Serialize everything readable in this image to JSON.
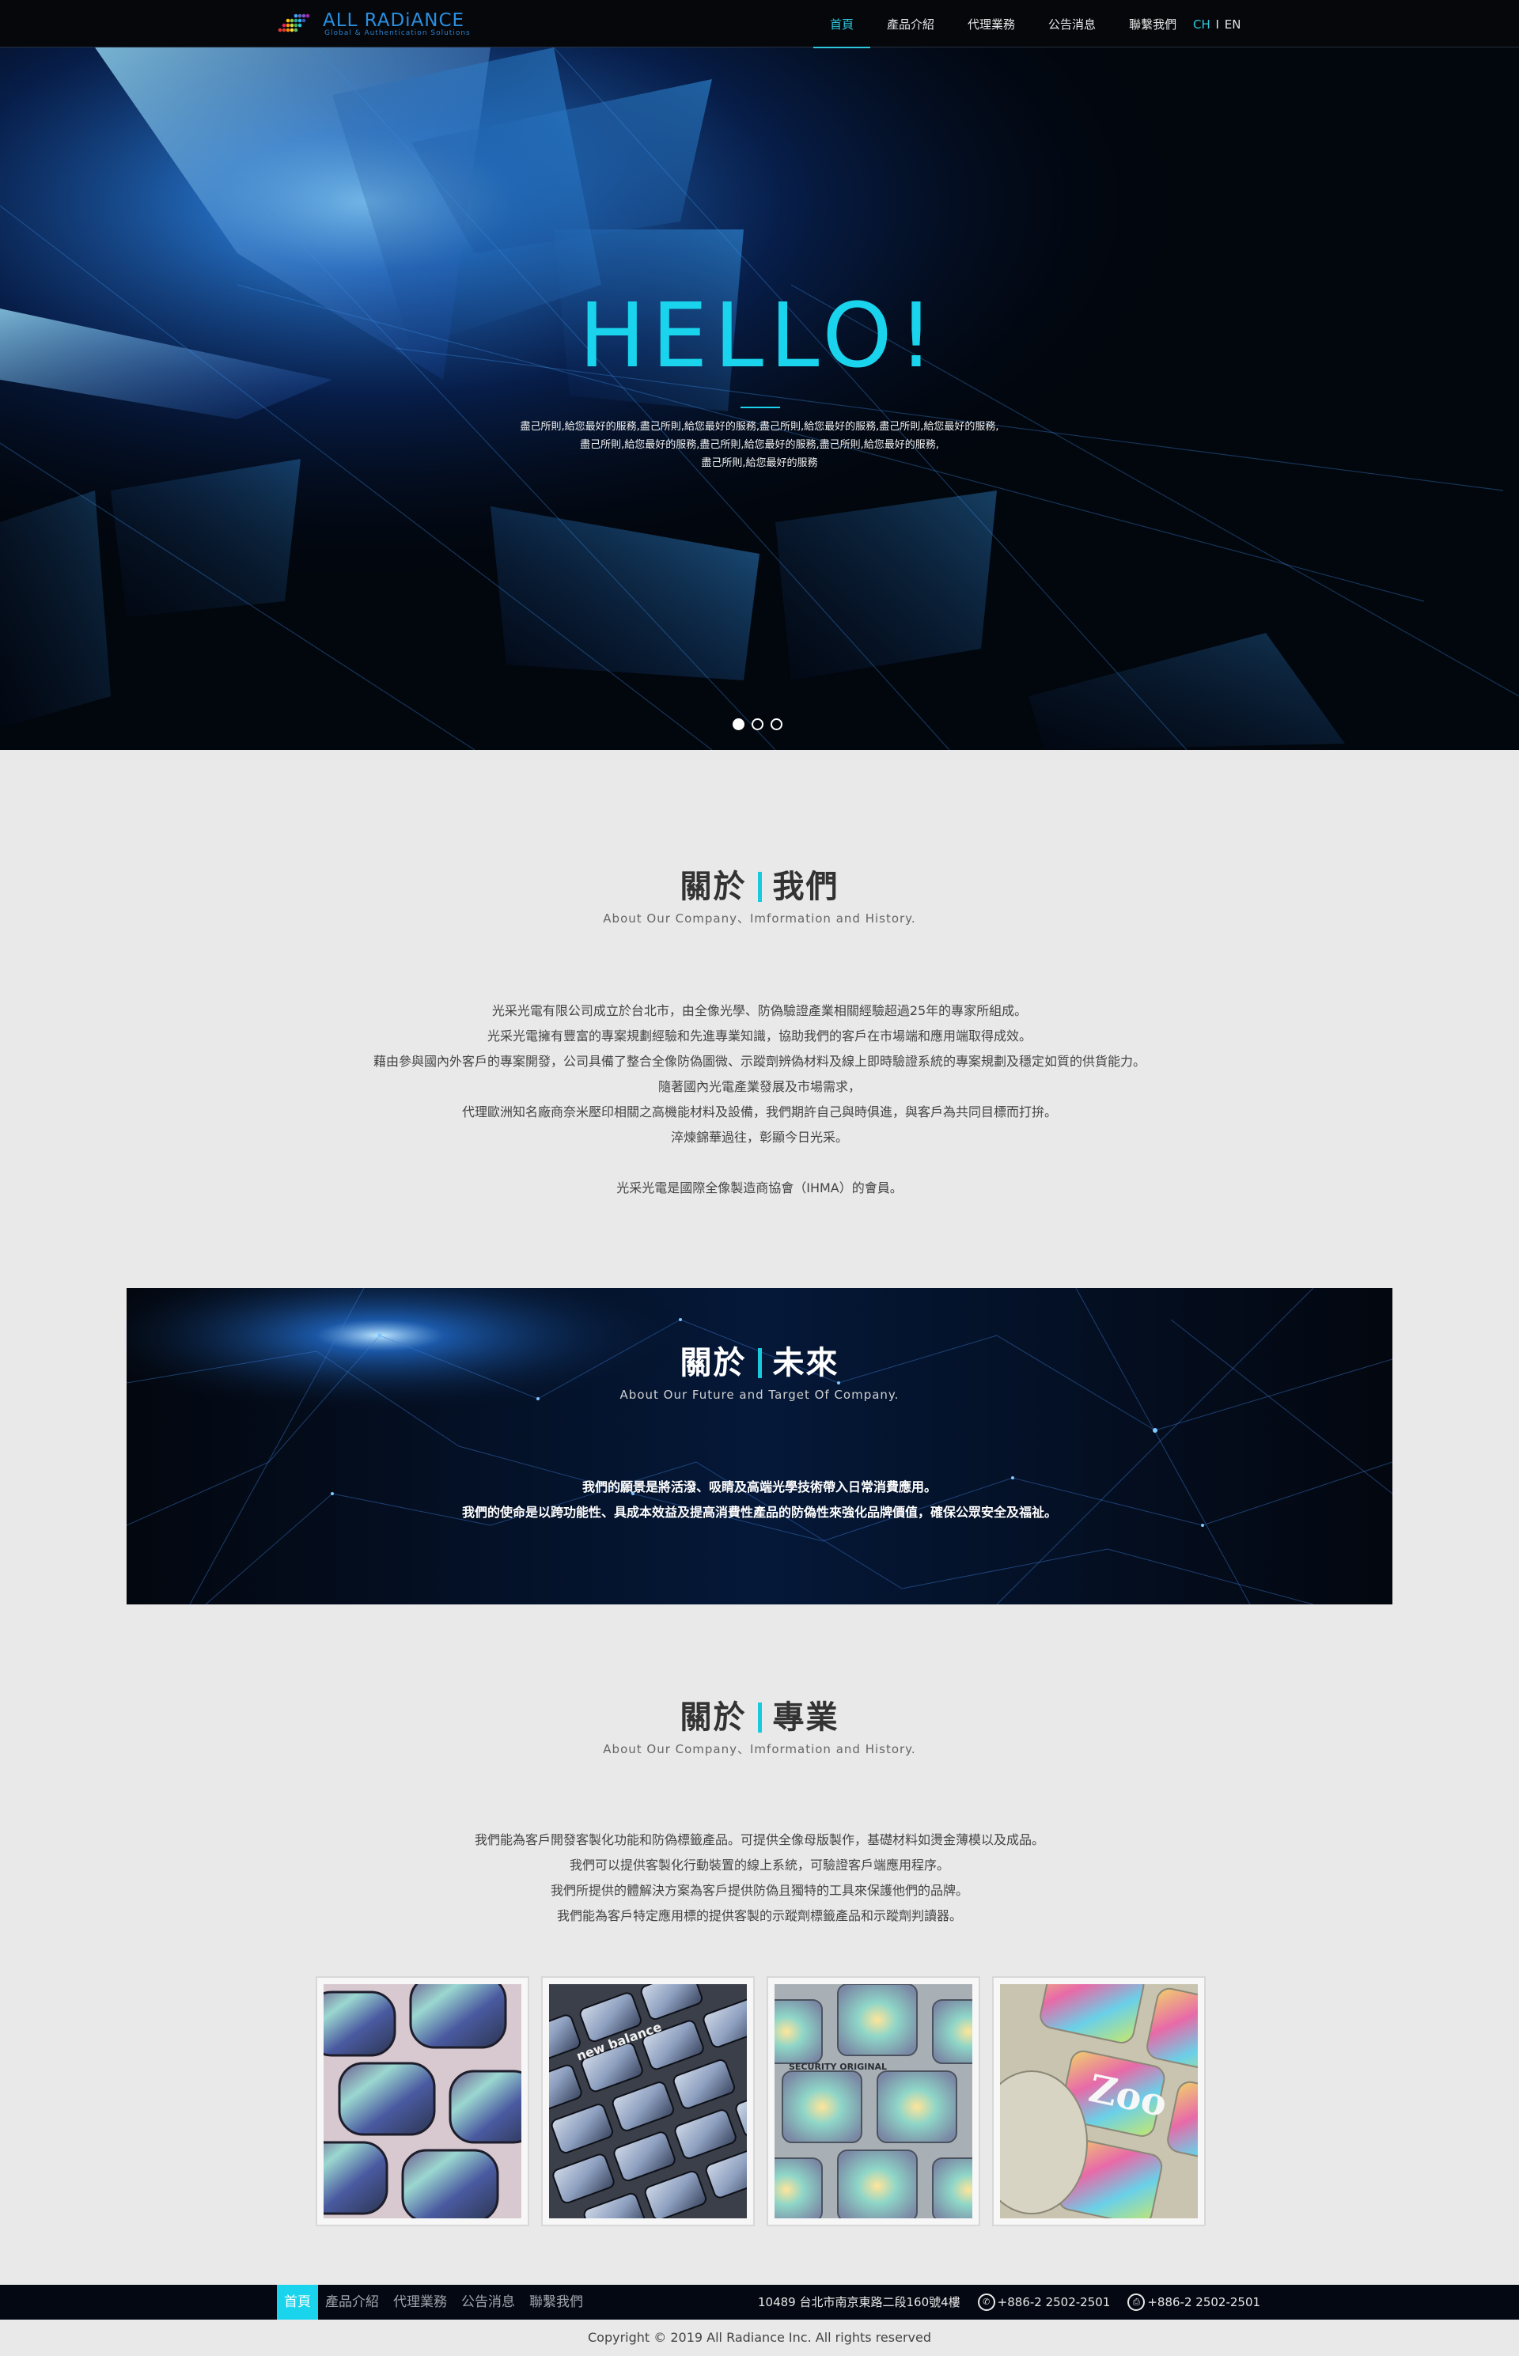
{
  "header": {
    "logo_text": "ALL RADiANCE",
    "logo_sub": "Global & Authentication Solutions",
    "nav": [
      {
        "label": "首頁"
      },
      {
        "label": "產品介紹"
      },
      {
        "label": "代理業務"
      },
      {
        "label": "公告消息"
      },
      {
        "label": "聯繫我們"
      }
    ],
    "active_nav": "首頁",
    "lang_ch": "CH",
    "lang_sep": "I",
    "lang_en": "EN"
  },
  "hero": {
    "title": "HELLO!",
    "text": "盡己所則,給您最好的服務,盡己所則,給您最好的服務,盡己所則,給您最好的服務,盡己所則,給您最好的服務,\n盡己所則,給您最好的服務,盡己所則,給您最好的服務,盡己所則,給您最好的服務,\n盡己所則,給您最好的服務",
    "slides": 3,
    "active_slide": 0
  },
  "about": {
    "title_left": "關於",
    "title_right": "我們",
    "subtitle": "About Our Company、Imformation and History.",
    "lines": [
      "光采光電有限公司成立於台北市，由全像光學、防偽驗證產業相關經驗超過25年的專家所組成。",
      "光采光電擁有豐富的專案規劃經驗和先進專業知識，協助我們的客戶在市場端和應用端取得成效。",
      "藉由參與國內外客戶的專案開發，公司具備了整合全像防偽圖微、示蹤劑辨偽材料及線上即時驗證系統的專案規劃及穩定如質的供貨能力。",
      "隨著國內光電產業發展及市場需求，",
      "代理歐洲知名廠商奈米壓印相關之高機能材料及設備，我們期許自己與時俱進，與客戶為共同目標而打拚。",
      "淬煉錦華過往，彰顯今日光采。"
    ],
    "member_line": "光采光電是國際全像製造商協會（IHMA）的會員。"
  },
  "future": {
    "title_left": "關於",
    "title_right": "未來",
    "subtitle": "About Our Future and Target Of Company.",
    "lines": [
      "我們的願景是將活潑、吸睛及高端光學技術帶入日常消費應用。",
      "我們的使命是以跨功能性、具成本效益及提高消費性產品的防偽性來強化品牌價值，確保公眾安全及福祉。"
    ]
  },
  "professional": {
    "title_left": "關於",
    "title_right": "專業",
    "subtitle": "About Our Company、Imformation and History.",
    "lines": [
      "我們能為客戶開發客製化功能和防偽標籤產品。可提供全像母版製作，基礎材料如燙金薄模以及成品。",
      "我們可以提供客製化行動裝置的線上系統，可驗證客戶端應用程序。",
      "我們所提供的體解決方案為客戶提供防偽且獨特的工具來保護他們的品牌。",
      "我們能為客戶特定應用標的提供客製的示蹤劑標籤產品和示蹤劑判讀器。"
    ],
    "gallery": [
      {
        "text": ""
      },
      {
        "text": "new balance"
      },
      {
        "text": "SECURITY ORIGINAL"
      },
      {
        "text": "Zoo"
      }
    ]
  },
  "footer": {
    "nav": [
      {
        "label": "首頁"
      },
      {
        "label": "產品介紹"
      },
      {
        "label": "代理業務"
      },
      {
        "label": "公告消息"
      },
      {
        "label": "聯繫我們"
      }
    ],
    "address": "10489 台北市南京東路二段160號4樓",
    "phone": "+886-2 2502-2501",
    "fax": "+886-2 2502-2501",
    "copyright": "Copyright © 2019  All Radiance Inc. All rights reserved"
  },
  "colors": {
    "accent": "#19d4ec",
    "header_bg": "#05070b",
    "section_bg": "#e9e9e9",
    "footer_bg": "#040812"
  },
  "icons": [
    "logo-mark-icon",
    "phone-icon",
    "fax-icon"
  ]
}
